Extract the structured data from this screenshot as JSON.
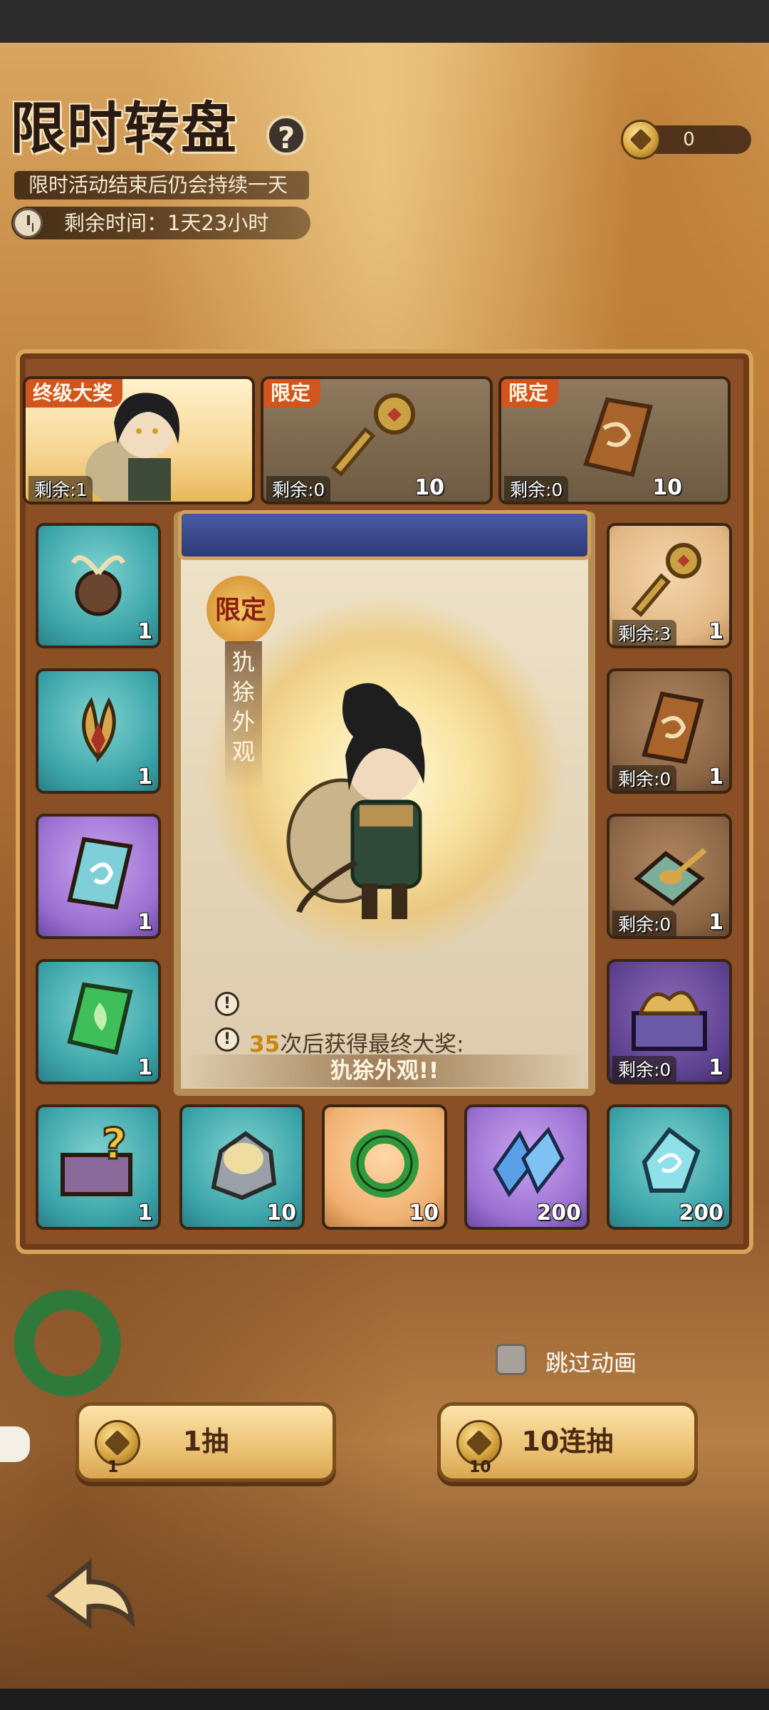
{
  "header": {
    "title": "限时转盘",
    "help_icon": "?",
    "subtitle": "限时活动结束后仍会持续一天",
    "timer_label": "剩余时间：1天23小时",
    "coin_balance": "0"
  },
  "top_row": [
    {
      "tag": "终级大奖",
      "remaining": "剩余:1",
      "count": "",
      "icon": "hero-portrait-icon"
    },
    {
      "tag": "限定",
      "remaining": "剩余:0",
      "count": "10",
      "icon": "golden-key-icon"
    },
    {
      "tag": "限定",
      "remaining": "剩余:0",
      "count": "10",
      "icon": "scroll-fragment-icon"
    }
  ],
  "left_column": [
    {
      "count": "1",
      "icon": "sprout-seed-icon"
    },
    {
      "count": "1",
      "icon": "bud-icon"
    },
    {
      "count": "1",
      "icon": "skill-scroll-icon"
    },
    {
      "count": "1",
      "icon": "leaf-scroll-icon"
    }
  ],
  "right_column": [
    {
      "remaining": "剩余:3",
      "count": "1",
      "icon": "golden-key-icon"
    },
    {
      "remaining": "剩余:0",
      "count": "1",
      "icon": "scroll-fragment-icon"
    },
    {
      "remaining": "剩余:0",
      "count": "1",
      "icon": "spoon-tray-icon"
    },
    {
      "remaining": "剩余:0",
      "count": "1",
      "icon": "treasure-chest-icon"
    }
  ],
  "bottom_row": [
    {
      "count": "1",
      "icon": "mystery-chest-icon"
    },
    {
      "count": "10",
      "icon": "ore-stone-icon"
    },
    {
      "count": "10",
      "icon": "jade-ring-icon"
    },
    {
      "count": "200",
      "icon": "blue-crystal-icon"
    },
    {
      "count": "200",
      "icon": "spirit-gem-icon"
    }
  ],
  "center": {
    "limited_badge": "限定",
    "skin_name_vertical": "犰狳外观",
    "progress_count": "35",
    "progress_text": "次后获得最终大奖:",
    "grand_prize": "犰狳外观!!"
  },
  "controls": {
    "skip_animation_label": "跳过动画",
    "skip_checked": false,
    "draw1_label": "1抽",
    "draw1_cost": "1",
    "draw10_label": "10连抽",
    "draw10_cost": "10"
  },
  "colors": {
    "accent_orange": "#d2551e",
    "gold": "#e9b85a",
    "frame_brown": "#8a4f24"
  }
}
